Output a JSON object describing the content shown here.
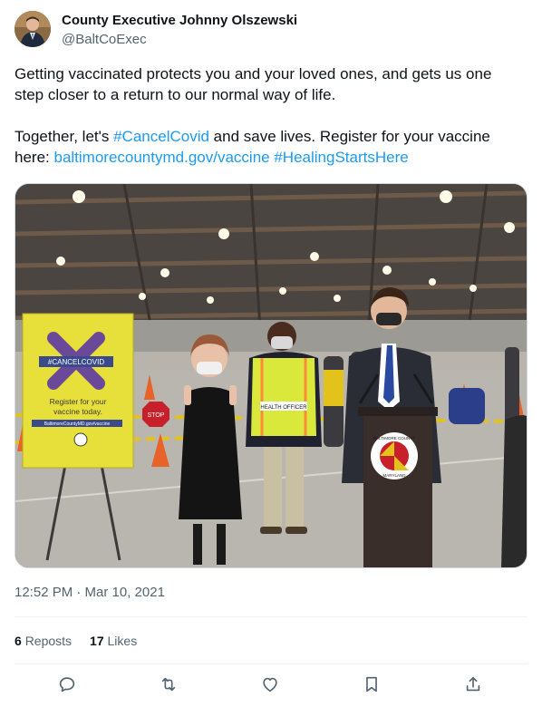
{
  "author": {
    "display_name": "County Executive Johnny Olszewski",
    "handle": "@BaltCoExec"
  },
  "tweet": {
    "paragraph1": "Getting vaccinated protects you and your loved ones, and gets us one step closer to a return to our normal way of life.",
    "p2_text_a": "Together, let's ",
    "p2_hashtag1": "#CancelCovid",
    "p2_text_b": " and save lives. Register for your vaccine here: ",
    "p2_url": "baltimorecountymd.gov/vaccine",
    "p2_space": " ",
    "p2_hashtag2": "#HealingStartsHere"
  },
  "photo_text": {
    "sign_badge": "#CANCELCOVID",
    "sign_line1": "Register for your",
    "sign_line2": "vaccine today.",
    "sign_url": "BaltimoreCountyMD.gov/vaccine",
    "vest_label": "HEALTH OFFICER",
    "seal_top": "BALTIMORE COUNTY",
    "seal_bottom": "MARYLAND",
    "stop_sign": "STOP"
  },
  "timestamp": "12:52 PM · Mar 10, 2021",
  "stats": {
    "reposts_count": "6",
    "reposts_label": "Reposts",
    "likes_count": "17",
    "likes_label": "Likes"
  },
  "actions": {
    "reply": "reply-icon",
    "repost": "repost-icon",
    "like": "heart-icon",
    "bookmark": "bookmark-icon",
    "share": "share-icon"
  },
  "colors": {
    "link": "#1d9bf0",
    "secondary_text": "#536471",
    "primary_text": "#0f1419",
    "divider": "#eff3f4"
  }
}
